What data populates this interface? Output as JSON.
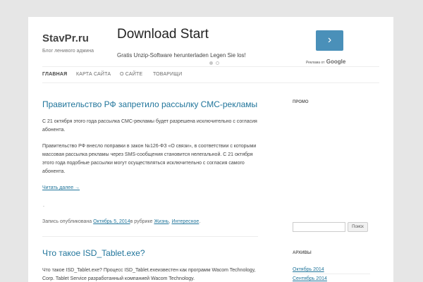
{
  "site": {
    "title": "StavPr.ru",
    "description": "Блог ленивого админа"
  },
  "ad": {
    "title": "Download Start",
    "subtitle": "Gratis Unzip-Software herunterladen Legen Sie los!",
    "button_label": "›",
    "badge_prefix": "Реклама от",
    "badge_brand": "Google"
  },
  "nav": {
    "items": [
      "ГЛАВНАЯ",
      "КАРТА САЙТА",
      "О САЙТЕ",
      "ТОВАРИЩИ"
    ]
  },
  "posts": [
    {
      "title": "Правительство РФ запретило рассылку СМС-рекламы",
      "paragraphs": [
        "С 21 октября этого года рассылка СМС-рекламы будет разрешена исключительно с согласия абонента.",
        "Правительство РФ внесло поправки в закон №126-ФЗ «О связи», в соответствии с которыми массовая рассылка рекламы через SMS-сообщения становится нелегальной. С 21 октября этого года подобные рассылки могут осуществляться исключительно с согласия самого абонента."
      ],
      "more_label": "Читать далее →",
      "dot": ".",
      "meta": {
        "prefix": "Запись опубликована",
        "date": "Октябрь 5, 2014",
        "in_rubric": "в рубрике",
        "category1": "Жизнь",
        "comma": ",",
        "category2": "Интересное",
        "suffix": "."
      }
    },
    {
      "title": "Что такое ISD_Tablet.exe?",
      "text": "Что такое ISD_Tablet.exe? Процесс ISD_Tablet.exeизвестен как программ Wacom Technology, Corp. Tablet Service разработанный компанией Wacom Technology."
    }
  ],
  "sidebar": {
    "promo_title": "ПРОМО",
    "search_placeholder": "",
    "search_button": "Поиск",
    "archives_title": "АРХИВЫ",
    "archives": [
      "Октябрь 2014",
      "Сентябрь 2014"
    ]
  }
}
